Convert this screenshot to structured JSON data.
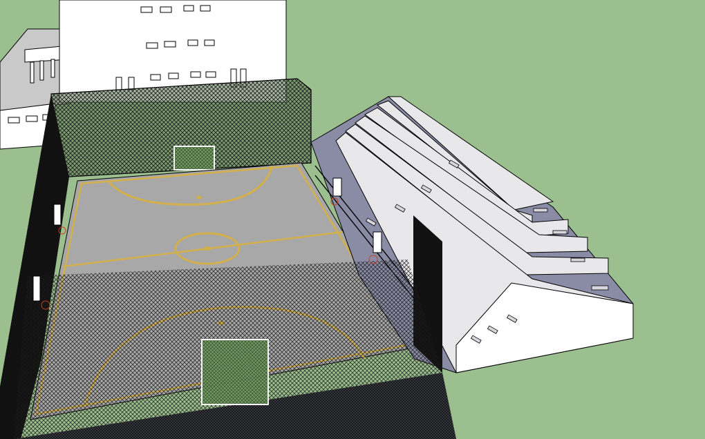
{
  "scene": {
    "colors": {
      "ground": "#9bbf8e",
      "building": "#ffffff",
      "roof": "#c9c9c9",
      "court": "#a8a8a8",
      "court_lines": "#d4b04a",
      "fence": "#1e1e1e",
      "fence_green": "#5a7a50",
      "bleacher_top": "#e8e8ea",
      "bleacher_side": "#8a8ca6",
      "goal_net": "#7fa06a"
    }
  }
}
